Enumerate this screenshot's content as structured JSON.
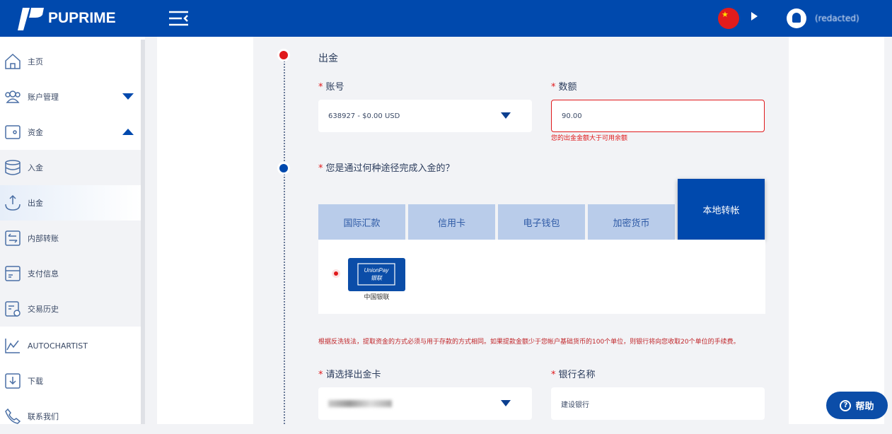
{
  "header": {
    "brand": "PUPRIME",
    "language": "中文",
    "username": "(redacted)"
  },
  "sidebar": {
    "items": [
      {
        "label": "主页",
        "icon": "home-icon"
      },
      {
        "label": "账户管理",
        "icon": "users-icon",
        "expanded": false
      },
      {
        "label": "资金",
        "icon": "wallet-icon",
        "expanded": true
      },
      {
        "label": "入金",
        "icon": "coins-icon"
      },
      {
        "label": "出金",
        "icon": "upload-icon",
        "active": true
      },
      {
        "label": "内部转账",
        "icon": "transfer-icon"
      },
      {
        "label": "支付信息",
        "icon": "card-icon"
      },
      {
        "label": "交易历史",
        "icon": "history-icon"
      },
      {
        "label": "AUTOCHARTIST",
        "icon": "chart-icon"
      },
      {
        "label": "下载",
        "icon": "download-icon"
      },
      {
        "label": "联系我们",
        "icon": "phone-icon"
      }
    ]
  },
  "form": {
    "section_title": "出金",
    "account_label": "账号",
    "account_value": "638927 - $0.00 USD",
    "amount_label": "数额",
    "amount_value": "90.00",
    "amount_error": "您的出金金额大于可用余额",
    "method_question": "您是通过何种途径完成入金的？",
    "tabs": [
      "国际汇款",
      "信用卡",
      "电子钱包",
      "加密货币",
      "本地转帐"
    ],
    "active_tab": "本地转帐",
    "method_option": "中国银联",
    "unionpay_logo": "UnionPay 银联",
    "notice": "根据反洗钱法，提取资金的方式必须与用于存款的方式相同。如果提款金额少于您帐户基础货币的100个单位，则银行将向您收取20个单位的手续费。",
    "card_label": "请选择出金卡",
    "bank_label": "银行名称",
    "bank_value": "建设银行",
    "required_mark": "*"
  },
  "help_label": "帮助",
  "colors": {
    "brand": "#0049ad",
    "error": "#e0191b"
  }
}
